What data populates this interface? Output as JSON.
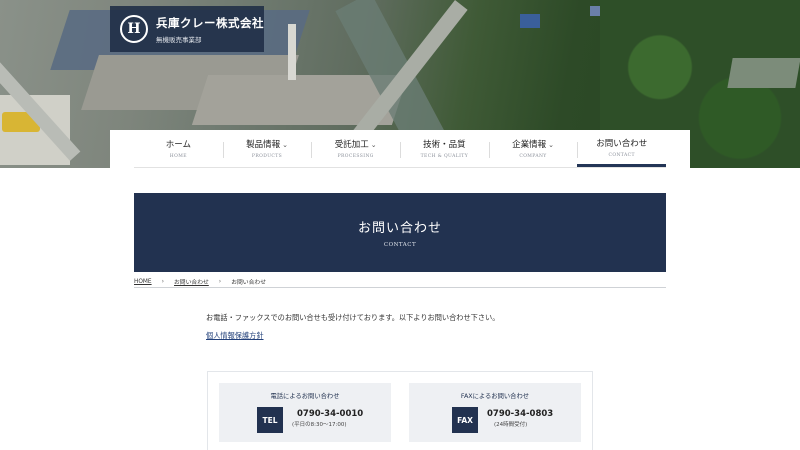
{
  "logo": {
    "mark": "H",
    "name": "兵庫クレー株式会社",
    "subtitle": "無機販売事業部"
  },
  "nav": {
    "items": [
      {
        "label": "ホーム",
        "en": "HOME",
        "has_dropdown": false,
        "active": false
      },
      {
        "label": "製品情報",
        "en": "PRODUCTS",
        "has_dropdown": true,
        "active": false
      },
      {
        "label": "受託加工",
        "en": "PROCESSING",
        "has_dropdown": true,
        "active": false
      },
      {
        "label": "技術・品質",
        "en": "TECH & QUALITY",
        "has_dropdown": false,
        "active": false
      },
      {
        "label": "企業情報",
        "en": "COMPANY",
        "has_dropdown": true,
        "active": false
      },
      {
        "label": "お問い合わせ",
        "en": "CONTACT",
        "has_dropdown": false,
        "active": true
      }
    ],
    "caret": "⌄"
  },
  "banner": {
    "title": "お問い合わせ",
    "subtitle": "CONTACT"
  },
  "breadcrumb": {
    "home": "HOME",
    "parent": "お問い合わせ",
    "current": "お問い合わせ",
    "separator": "›"
  },
  "intro": {
    "text": "お電話・ファックスでのお問い合せも受け付けております。以下よりお問い合わせ下さい。",
    "privacy_link": "個人情報保護方針"
  },
  "contact": {
    "tel": {
      "title": "電話によるお問い合わせ",
      "badge": "TEL",
      "number": "0790-34-0010",
      "note": "(平日の8:30〜17:00)"
    },
    "fax": {
      "title": "FAXによるお問い合わせ",
      "badge": "FAX",
      "number": "0790-34-0803",
      "note": "(24時間受付)"
    }
  },
  "colors": {
    "navy": "#223250",
    "card_bg": "#eef0f3"
  }
}
